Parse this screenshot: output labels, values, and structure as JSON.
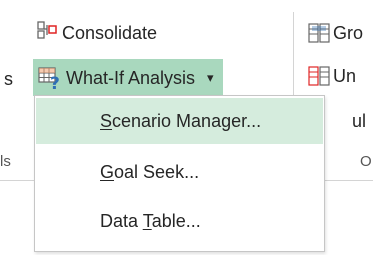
{
  "ribbon": {
    "left_group": {
      "row2_partial": "s",
      "row4_partial": "ls"
    },
    "consolidate_label": "Consolidate",
    "whatif_label": "What-If Analysis",
    "whatif_arrow": "▾",
    "right_group": {
      "group_partial": "Gro",
      "ungroup_partial": "Un",
      "subtotal_partial": "ul",
      "outline_partial": "O"
    }
  },
  "menu": {
    "items": [
      {
        "pre": "",
        "accel": "S",
        "post": "cenario Manager..."
      },
      {
        "pre": "",
        "accel": "G",
        "post": "oal Seek..."
      },
      {
        "pre": "Data ",
        "accel": "T",
        "post": "able..."
      }
    ]
  },
  "colors": {
    "highlight_button": "#a9d8be",
    "highlight_menu_item": "#d5ecdd",
    "accent_red": "#e02424",
    "accent_blue": "#2f6fb5"
  }
}
